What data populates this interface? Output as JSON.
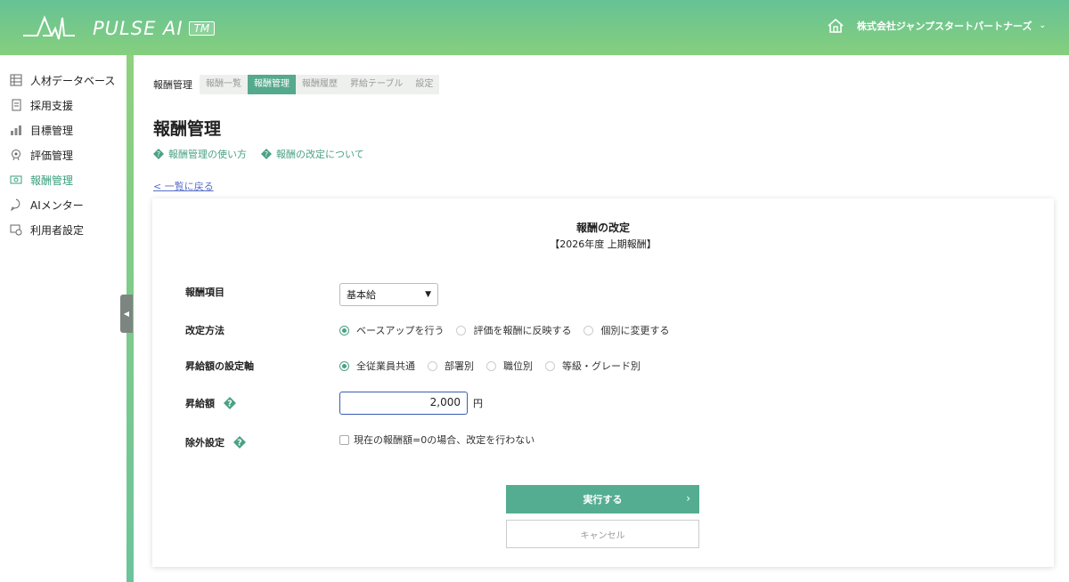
{
  "header": {
    "brand": "PULSE AI",
    "tm": "TM",
    "company": "株式会社ジャンプスタートパートナーズ"
  },
  "sidebar": {
    "items": [
      {
        "label": "人材データベース",
        "icon": "database-icon"
      },
      {
        "label": "採用支援",
        "icon": "recruit-icon"
      },
      {
        "label": "目標管理",
        "icon": "goal-icon"
      },
      {
        "label": "評価管理",
        "icon": "evaluation-icon"
      },
      {
        "label": "報酬管理",
        "icon": "reward-icon",
        "active": true
      },
      {
        "label": "AIメンター",
        "icon": "ai-mentor-icon"
      },
      {
        "label": "利用者設定",
        "icon": "user-settings-icon"
      }
    ]
  },
  "breadcrumb": {
    "label": "報酬管理",
    "tabs": [
      "報酬一覧",
      "報酬管理",
      "報酬履歴",
      "昇給テーブル",
      "設定"
    ],
    "active_tab": "報酬管理"
  },
  "page": {
    "title": "報酬管理",
    "help_links": [
      "報酬管理の使い方",
      "報酬の改定について"
    ],
    "back": "< 一覧に戻る"
  },
  "card": {
    "title": "報酬の改定",
    "subtitle": "【2026年度 上期報酬】",
    "fields": {
      "item": {
        "label": "報酬項目",
        "value": "基本給"
      },
      "method": {
        "label": "改定方法",
        "options": [
          "ベースアップを行う",
          "評価を報酬に反映する",
          "個別に変更する"
        ],
        "selected": 0
      },
      "axis": {
        "label": "昇給額の設定軸",
        "options": [
          "全従業員共通",
          "部署別",
          "職位別",
          "等級・グレード別"
        ],
        "selected": 0
      },
      "amount": {
        "label": "昇給額",
        "value": "2,000",
        "unit": "円"
      },
      "exclude": {
        "label": "除外設定",
        "checkbox_label": "現在の報酬額=0の場合、改定を行わない",
        "checked": false
      }
    },
    "run_label": "実行する",
    "cancel_label": "キャンセル"
  },
  "colors": {
    "accent": "#55ad91",
    "header_gradient_start": "#66c295",
    "header_gradient_end": "#86cf7e",
    "link": "#5a6fc8",
    "input_focus": "#3a5bb8"
  }
}
